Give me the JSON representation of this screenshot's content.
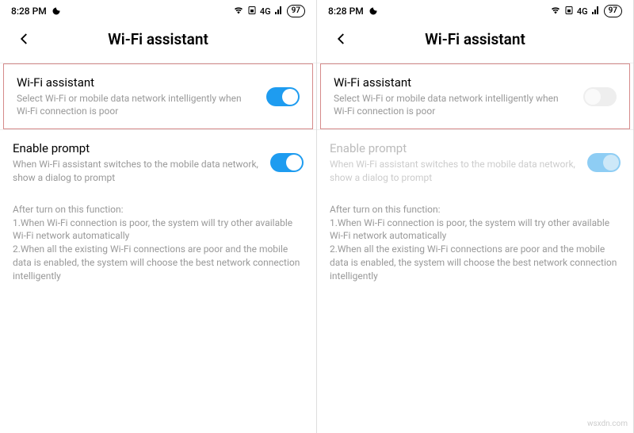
{
  "watermark": "wsxdn.com",
  "left": {
    "status": {
      "time": "8:28 PM",
      "battery": "97",
      "netLabel": "4G"
    },
    "header": {
      "title": "Wi-Fi assistant"
    },
    "wifiAssistant": {
      "title": "Wi-Fi assistant",
      "desc": "Select Wi-Fi or mobile data network intelligently when Wi-Fi connection is poor",
      "on": true
    },
    "enablePrompt": {
      "title": "Enable prompt",
      "desc": "When Wi-Fi assistant switches to the mobile data network, show a dialog to prompt",
      "on": true,
      "disabled": false
    },
    "info": "After turn on this function:\n1.When Wi-Fi connection is poor, the system will try other available Wi-Fi network automatically\n2.When all the existing Wi-Fi connections are poor and the mobile data is enabled, the system will choose the best network connection intelligently"
  },
  "right": {
    "status": {
      "time": "8:28 PM",
      "battery": "97",
      "netLabel": "4G"
    },
    "header": {
      "title": "Wi-Fi assistant"
    },
    "wifiAssistant": {
      "title": "Wi-Fi assistant",
      "desc": "Select Wi-Fi or mobile data network intelligently when Wi-Fi connection is poor",
      "on": false
    },
    "enablePrompt": {
      "title": "Enable prompt",
      "desc": "When Wi-Fi assistant switches to the mobile data network, show a dialog to prompt",
      "on": true,
      "disabled": true
    },
    "info": "After turn on this function:\n1.When Wi-Fi connection is poor, the system will try other available Wi-Fi network automatically\n2.When all the existing Wi-Fi connections are poor and the mobile data is enabled, the system will choose the best network connection intelligently"
  }
}
